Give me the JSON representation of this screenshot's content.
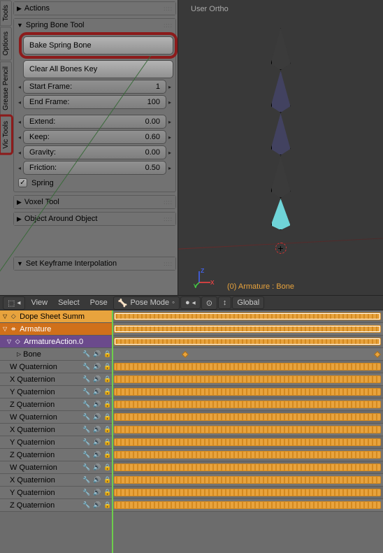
{
  "tabs": {
    "tools": "Tools",
    "options": "Options",
    "grease": "Grease Pencil",
    "vic": "Vic Tools"
  },
  "panels": {
    "actions": "Actions",
    "spring": "Spring Bone Tool",
    "bake_btn": "Bake Spring Bone",
    "clear_btn": "Clear All Bones Key",
    "start_frame": {
      "label": "Start Frame:",
      "value": "1"
    },
    "end_frame": {
      "label": "End Frame:",
      "value": "100"
    },
    "extend": {
      "label": "Extend:",
      "value": "0.00"
    },
    "keep": {
      "label": "Keep:",
      "value": "0.60"
    },
    "gravity": {
      "label": "Gravity:",
      "value": "0.00"
    },
    "friction": {
      "label": "Friction:",
      "value": "0.50"
    },
    "spring_chk": "Spring",
    "voxel": "Voxel Tool",
    "around": "Object Around Object",
    "interp": "Set Keyframe Interpolation"
  },
  "viewport": {
    "proj": "User Ortho",
    "active": "(0) Armature : Bone"
  },
  "header": {
    "view": "View",
    "select": "Select",
    "pose": "Pose",
    "mode": "Pose Mode",
    "global": "Global"
  },
  "dopesheet": {
    "summary": "Dope Sheet Summ",
    "scene": "Armature",
    "action": "ArmatureAction.0",
    "bone": "Bone",
    "channels": [
      "W Quaternion",
      "X Quaternion",
      "Y Quaternion",
      "Z Quaternion",
      "W Quaternion",
      "X Quaternion",
      "Y Quaternion",
      "Z Quaternion",
      "W Quaternion",
      "X Quaternion",
      "Y Quaternion",
      "Z Quaternion"
    ]
  }
}
